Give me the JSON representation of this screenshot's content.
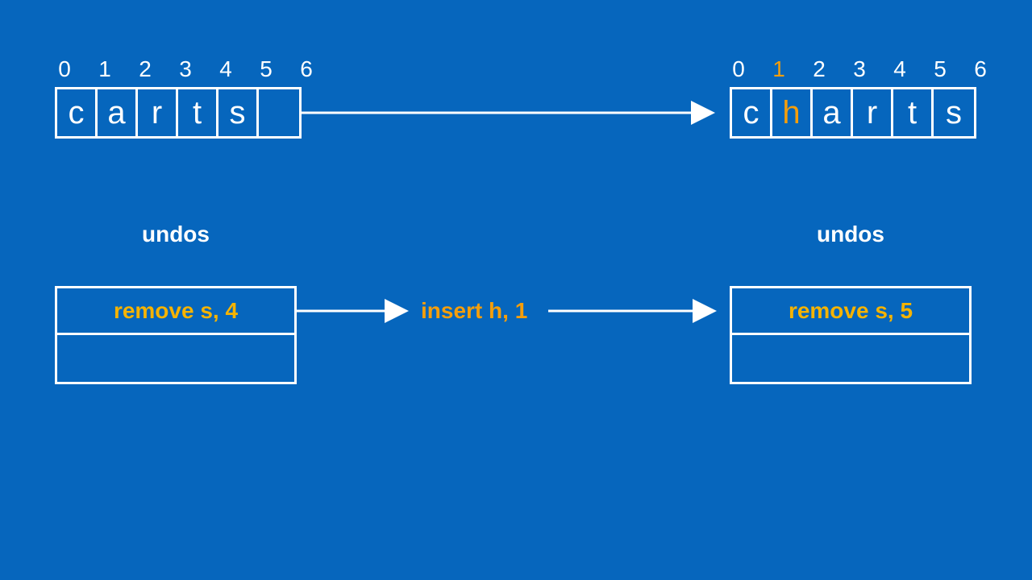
{
  "left_array": {
    "indices": [
      "0",
      "1",
      "2",
      "3",
      "4",
      "5",
      "6"
    ],
    "highlight_index": -1,
    "cells": [
      "c",
      "a",
      "r",
      "t",
      "s",
      ""
    ],
    "highlight_cell": -1
  },
  "right_array": {
    "indices": [
      "0",
      "1",
      "2",
      "3",
      "4",
      "5",
      "6"
    ],
    "highlight_index": 1,
    "cells": [
      "c",
      "h",
      "a",
      "r",
      "t",
      "s"
    ],
    "highlight_cell": 1
  },
  "operation": "insert h, 1",
  "undo_left": {
    "label": "undos",
    "slots": [
      "remove s, 4",
      ""
    ]
  },
  "undo_right": {
    "label": "undos",
    "slots": [
      "remove s, 5",
      ""
    ]
  }
}
